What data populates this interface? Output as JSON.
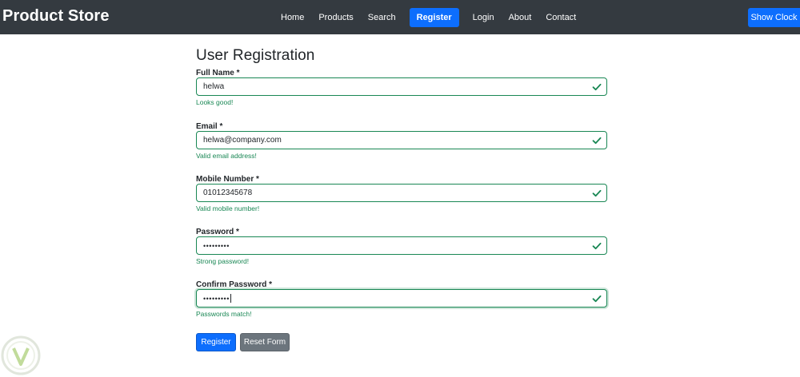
{
  "navbar": {
    "brand": "Product Store",
    "links": [
      {
        "label": "Home"
      },
      {
        "label": "Products"
      },
      {
        "label": "Search"
      },
      {
        "label": "Register",
        "active": true
      },
      {
        "label": "Login"
      },
      {
        "label": "About"
      },
      {
        "label": "Contact"
      }
    ],
    "clock_button": "Show Clock"
  },
  "form": {
    "title": "User Registration",
    "fields": [
      {
        "label": "Full Name *",
        "value": "helwa",
        "feedback": "Looks good!"
      },
      {
        "label": "Email *",
        "value": "helwa@company.com",
        "feedback": "Valid email address!"
      },
      {
        "label": "Mobile Number *",
        "value": "01012345678",
        "feedback": "Valid mobile number!"
      },
      {
        "label": "Password *",
        "value": "•••••••••",
        "feedback": "Strong password!"
      },
      {
        "label": "Confirm Password *",
        "value": "•••••••••",
        "feedback": "Passwords match!"
      }
    ],
    "register_button": "Register",
    "reset_button": "Reset Form"
  },
  "colors": {
    "navbar_bg": "#343a40",
    "primary": "#0d6efd",
    "secondary": "#6c757d",
    "success": "#198754"
  }
}
